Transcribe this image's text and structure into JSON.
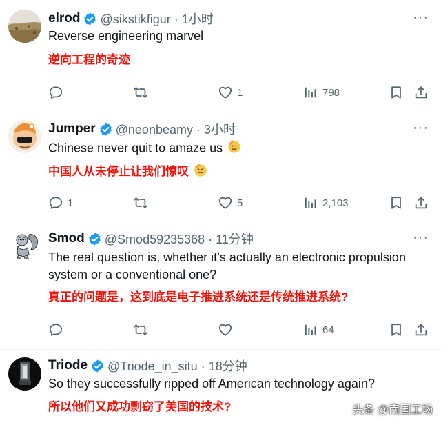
{
  "tweets": [
    {
      "name": "elrod",
      "handle": "@sikstikfigur · 1小时",
      "text_en": "Reverse engineering marvel",
      "text_cn": "逆向工程的奇迹",
      "replies": "",
      "likes": "1",
      "views": "798",
      "avatar_icon": "landscape-avatar"
    },
    {
      "name": "Jumper",
      "handle": "@neonbeamy · 3小时",
      "text_en": "Chinese never quit to amaze us",
      "text_cn": "中国人从未停止让我们惊叹",
      "replies": "1",
      "likes": "5",
      "views": "2,103",
      "avatar_icon": "cartoon-avatar",
      "emoji": "saluting-face"
    },
    {
      "name": "Smod",
      "handle": "@Smod59235368 · 11分钟",
      "text_en_1": "The real question is, whether it’s actually an electronic propulsion",
      "text_en_2": "system or a conventional one?",
      "text_cn": "真正的问题是，这到底是电子推进系统还是传统推进系统?",
      "replies": "",
      "likes": "",
      "views": "64",
      "avatar_icon": "squirrel-avatar"
    },
    {
      "name": "Triode",
      "handle": "@Triode_in_situ · 18分钟",
      "text_en": "So they successfully ripped off American technology again?",
      "text_cn": "所以他们又成功剽窃了美国的技术?",
      "avatar_icon": "vacuum-tube-avatar"
    }
  ],
  "watermark": "头条 @南国工场",
  "colors": {
    "verified": "#1d9bf0",
    "muted": "#536471",
    "translation": "#e8160c"
  }
}
